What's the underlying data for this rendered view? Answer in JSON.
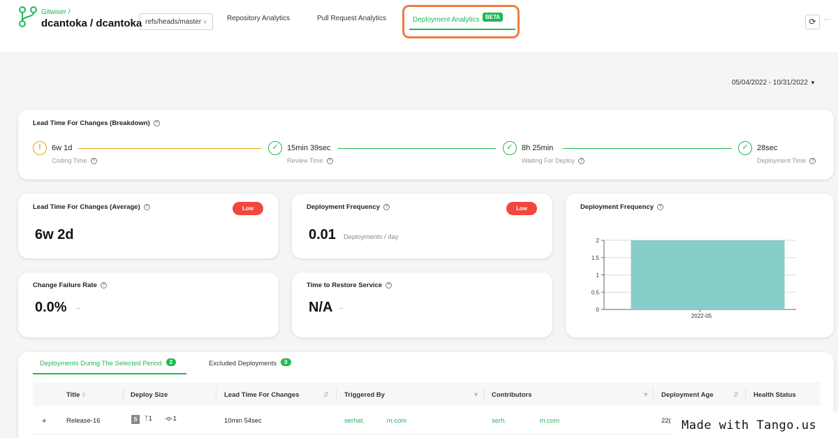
{
  "header": {
    "org": "Gitwiser /",
    "repo": "dcantoka / dcantoka",
    "branch": "refs/heads/master",
    "tabs": [
      "Repository Analytics",
      "Pull Request Analytics",
      "Deployment Analytics"
    ],
    "beta": "BETA",
    "more": "···"
  },
  "date_range": "05/04/2022 - 10/31/2022",
  "breakdown": {
    "title": "Lead Time For Changes (Breakdown)",
    "steps": [
      {
        "value": "6w 1d",
        "label": "Coding Time"
      },
      {
        "value": "15min 39sec",
        "label": "Review Time"
      },
      {
        "value": "8h 25min",
        "label": "Waiting For Deploy"
      },
      {
        "value": "28sec",
        "label": "Deployment Time"
      }
    ]
  },
  "metrics": {
    "lead_time": {
      "title": "Lead Time For Changes (Average)",
      "value": "6w 2d",
      "badge": "Low"
    },
    "deploy_freq": {
      "title": "Deployment Frequency",
      "value": "0.01",
      "unit": "Deployments / day",
      "badge": "Low"
    },
    "cfr": {
      "title": "Change Failure Rate",
      "value": "0.0%",
      "trend": "–"
    },
    "ttr": {
      "title": "Time to Restore Service",
      "value": "N/A",
      "trend": "–"
    }
  },
  "chart_card": {
    "title": "Deployment Frequency"
  },
  "chart_data": {
    "type": "bar",
    "categories": [
      "2022-05"
    ],
    "values": [
      2
    ],
    "ylim": [
      0,
      2
    ],
    "yticks": [
      "0",
      "0.5",
      "1",
      "1.5",
      "2"
    ],
    "grid": true,
    "color": "#87cdc8"
  },
  "table": {
    "tabs": [
      {
        "label": "Deployments During The Selected Period",
        "count": "2"
      },
      {
        "label": "Excluded Deployments",
        "count": "0"
      }
    ],
    "columns": [
      "Title",
      "Deploy Size",
      "Lead Time For Changes",
      "Triggered By",
      "Contributors",
      "Deployment Age",
      "Health Status"
    ],
    "rows": [
      {
        "expand": "+",
        "title": "Release-16",
        "size_badge": "S",
        "branches": "1",
        "commits": "1",
        "lead_time": "10min 54sec",
        "triggered_by": "serhat.            m.com",
        "contributors": "serh.                  m.com",
        "age": "22("
      }
    ]
  },
  "watermark": "Made with Tango.us",
  "colors": {
    "accent": "#1db954",
    "danger": "#f0473e",
    "warning": "#e6a317",
    "highlight": "#f07a43"
  }
}
